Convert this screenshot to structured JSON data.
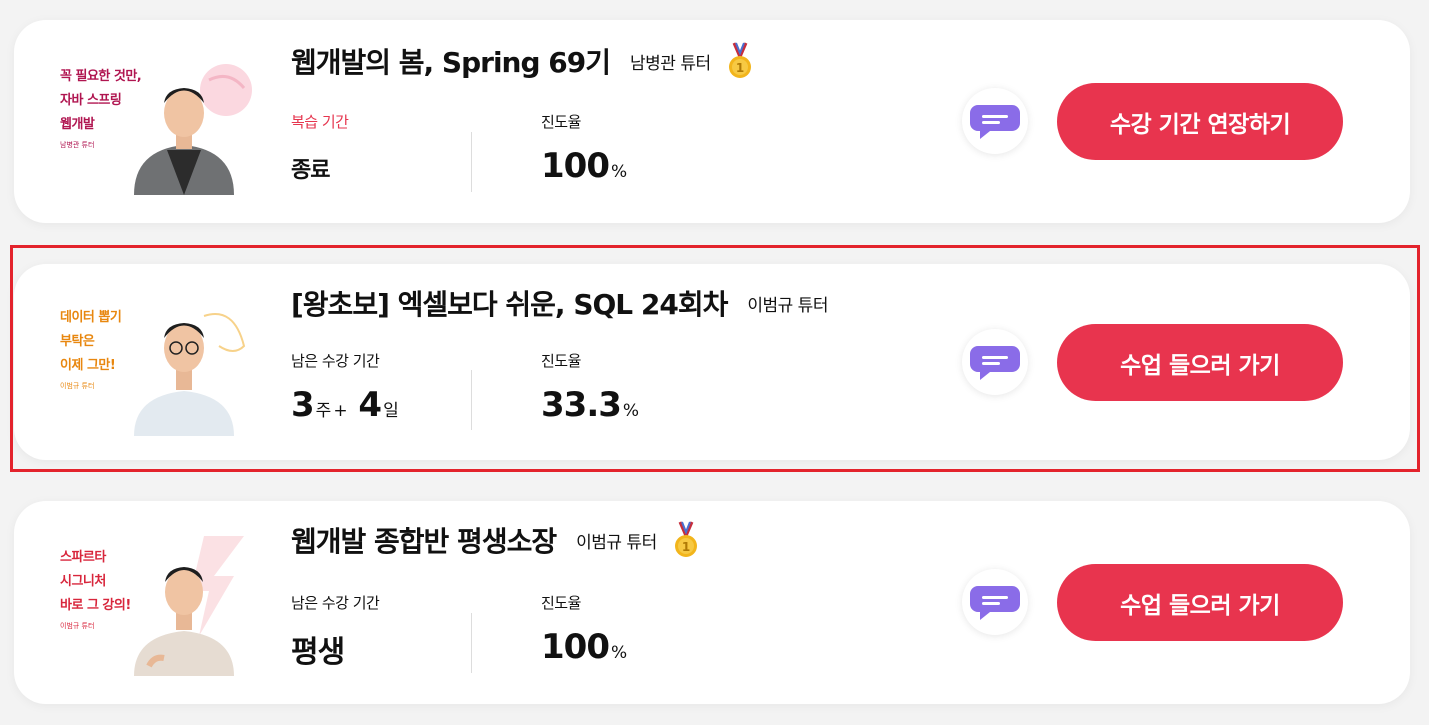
{
  "courses": [
    {
      "thumbnail": {
        "headline": "꼭 필요한 것만,\n자바 스프링\n웹개발",
        "tutor": "남병관 튜터",
        "text_color": "#b01550"
      },
      "title": "웹개발의 봄, Spring 69기",
      "tutor": "남병관 튜터",
      "medal_icon": "gold-medal-icon",
      "stats": [
        {
          "label": "복습 기간",
          "value": "종료"
        },
        {
          "label": "진도율",
          "value": "100",
          "unit": "%"
        }
      ],
      "chat_icon": "chat-bubble-icon",
      "cta_label": "수강 기간 연장하기"
    },
    {
      "thumbnail": {
        "headline": "데이터 뽑기\n부탁은\n이제 그만!",
        "tutor": "이범규 튜터",
        "text_color": "#e8870f"
      },
      "title": "[왕초보] 엑셀보다 쉬운, SQL 24회차",
      "tutor": "이범규 튜터",
      "stats": [
        {
          "label": "남은 수강 기간",
          "weeks": "3",
          "weeks_unit": "주",
          "plus": "+",
          "days": "4",
          "days_unit": "일"
        },
        {
          "label": "진도율",
          "value": "33.3",
          "unit": "%"
        }
      ],
      "chat_icon": "chat-bubble-icon",
      "cta_label": "수업 들으러 가기"
    },
    {
      "thumbnail": {
        "headline": "스파르타\n시그니처\n바로 그 강의!",
        "tutor": "이범규 튜터",
        "text_color": "#d8263c"
      },
      "title": "웹개발 종합반 평생소장",
      "tutor": "이범규 튜터",
      "medal_icon": "gold-medal-icon",
      "stats": [
        {
          "label": "남은 수강 기간",
          "value": "평생"
        },
        {
          "label": "진도율",
          "value": "100",
          "unit": "%"
        }
      ],
      "chat_icon": "chat-bubble-icon",
      "cta_label": "수업 들으러 가기"
    }
  ],
  "colors": {
    "accent": "#e8344e",
    "highlight_frame": "#e3232c",
    "chat_icon": "#8a6ce8",
    "review_label": "#e6364f"
  }
}
